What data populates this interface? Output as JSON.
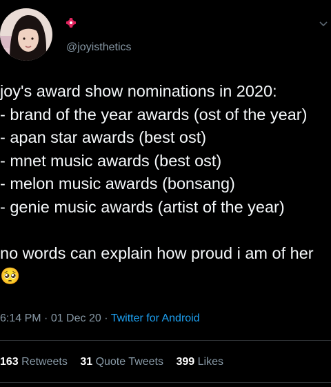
{
  "profile": {
    "handle": "@joyisthetics",
    "avatar_icon": "profile-photo"
  },
  "tweet": {
    "text": "joy's award show nominations in 2020:\n- brand of the year awards (ost of the year)\n- apan star awards (best ost)\n- mnet music awards (best ost)\n- melon music awards (bonsang)\n- genie music awards (artist of the year)\n\nno words can explain how proud i am of her 🥺"
  },
  "meta": {
    "time": "6:14 PM",
    "sep1": " · ",
    "date": "01 Dec 20",
    "sep2": " · ",
    "source": "Twitter for Android"
  },
  "stats": {
    "retweets_count": "163",
    "retweets_label": "Retweets",
    "quotes_count": "31",
    "quotes_label": "Quote Tweets",
    "likes_count": "399",
    "likes_label": "Likes"
  },
  "colors": {
    "background": "#000000",
    "text": "#f5f8fa",
    "muted": "#8899a6",
    "link": "#1da1f2",
    "badge": "#e0245e"
  }
}
